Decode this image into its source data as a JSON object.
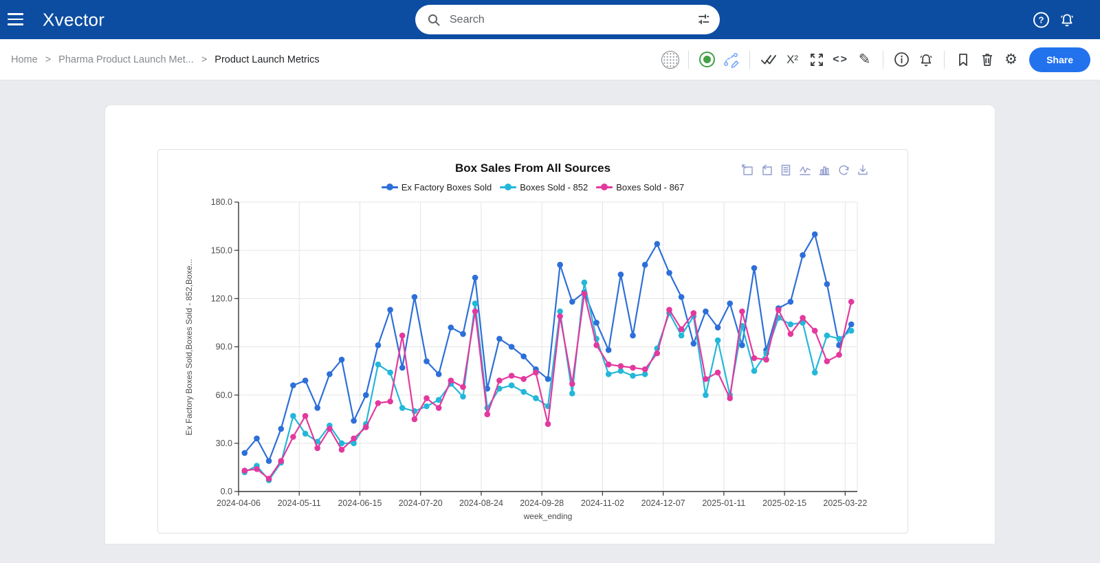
{
  "topbar": {
    "logo": "Xvector",
    "search": {
      "placeholder": "Search"
    }
  },
  "breadcrumb": {
    "separator": ">",
    "items": [
      {
        "label": "Home",
        "current": false
      },
      {
        "label": "Pharma Product Launch Met...",
        "current": false
      },
      {
        "label": "Product Launch Metrics",
        "current": true
      }
    ]
  },
  "toolbar": {
    "share_label": "Share",
    "icon_names": [
      "dotted-circle",
      "green-status",
      "flow-edit",
      "double-check",
      "superscript",
      "fullscreen",
      "code",
      "edit-pencil",
      "info",
      "alert-bell",
      "bookmark",
      "delete",
      "settings-gear"
    ]
  },
  "icons": {
    "help": "?",
    "x2": "X²",
    "code": "<>",
    "pencil": "✎",
    "gear": "⚙",
    "info": "i"
  },
  "colors": {
    "topbar": "#0c4da2",
    "share_button": "#2272ee",
    "series_blue": "#2d6fd8",
    "series_cyan": "#23b7d9",
    "series_magenta": "#e3399e",
    "toolbox_icon": "#8f9bce",
    "green_status": "#43a047"
  },
  "chart_data": {
    "type": "line",
    "title": "Box Sales From All Sources",
    "xlabel": "week_ending",
    "ylabel": "Ex Factory Boxes Sold,Boxes Sold - 852,Boxe...",
    "ylim": [
      0,
      180
    ],
    "ytick_interval": 30,
    "grid": true,
    "legend_position": "top",
    "x_tick_labels": [
      "2024-04-06",
      "2024-05-11",
      "2024-06-15",
      "2024-07-20",
      "2024-08-24",
      "2024-09-28",
      "2024-11-02",
      "2024-12-07",
      "2025-01-11",
      "2025-02-15",
      "2025-03-22"
    ],
    "categories": [
      "2024-04-06",
      "2024-04-13",
      "2024-04-20",
      "2024-04-27",
      "2024-05-04",
      "2024-05-11",
      "2024-05-18",
      "2024-05-25",
      "2024-06-01",
      "2024-06-08",
      "2024-06-15",
      "2024-06-22",
      "2024-06-29",
      "2024-07-06",
      "2024-07-13",
      "2024-07-20",
      "2024-07-27",
      "2024-08-03",
      "2024-08-10",
      "2024-08-17",
      "2024-08-24",
      "2024-08-31",
      "2024-09-07",
      "2024-09-14",
      "2024-09-21",
      "2024-09-28",
      "2024-10-05",
      "2024-10-12",
      "2024-10-19",
      "2024-10-26",
      "2024-11-02",
      "2024-11-09",
      "2024-11-16",
      "2024-11-23",
      "2024-11-30",
      "2024-12-07",
      "2024-12-14",
      "2024-12-21",
      "2024-12-28",
      "2025-01-04",
      "2025-01-11",
      "2025-01-18",
      "2025-01-25",
      "2025-02-01",
      "2025-02-08",
      "2025-02-15",
      "2025-02-22",
      "2025-03-01",
      "2025-03-08",
      "2025-03-15",
      "2025-03-22"
    ],
    "series": [
      {
        "name": "Ex Factory Boxes Sold",
        "color": "#2d6fd8",
        "values": [
          24,
          33,
          19,
          39,
          66,
          69,
          52,
          73,
          82,
          44,
          60,
          91,
          113,
          77,
          121,
          81,
          73,
          102,
          98,
          133,
          64,
          95,
          90,
          84,
          76,
          70,
          141,
          118,
          124,
          105,
          88,
          135,
          97,
          141,
          154,
          136,
          121,
          92,
          112,
          102,
          117,
          91,
          139,
          88,
          114,
          118,
          147,
          160,
          129,
          91,
          104
        ]
      },
      {
        "name": "Boxes Sold - 852",
        "color": "#23b7d9",
        "values": [
          12,
          16,
          7,
          18,
          47,
          36,
          31,
          41,
          30,
          30,
          42,
          79,
          74,
          52,
          50,
          53,
          57,
          67,
          59,
          117,
          52,
          64,
          66,
          62,
          58,
          53,
          112,
          61,
          130,
          95,
          73,
          75,
          72,
          73,
          89,
          111,
          97,
          109,
          60,
          94,
          60,
          103,
          75,
          86,
          108,
          104,
          105,
          74,
          97,
          95,
          100
        ]
      },
      {
        "name": "Boxes Sold - 867",
        "color": "#e3399e",
        "values": [
          13,
          14,
          8,
          19,
          34,
          47,
          27,
          39,
          26,
          33,
          40,
          55,
          56,
          97,
          45,
          58,
          52,
          69,
          65,
          112,
          48,
          69,
          72,
          70,
          74,
          42,
          109,
          67,
          123,
          91,
          79,
          78,
          77,
          76,
          86,
          113,
          101,
          111,
          70,
          74,
          58,
          112,
          83,
          82,
          113,
          98,
          108,
          100,
          81,
          85,
          118
        ]
      }
    ],
    "toolbox_icons": [
      "zoom-box",
      "zoom-back",
      "data-view",
      "line-chart",
      "bar-chart",
      "restore",
      "download"
    ]
  }
}
